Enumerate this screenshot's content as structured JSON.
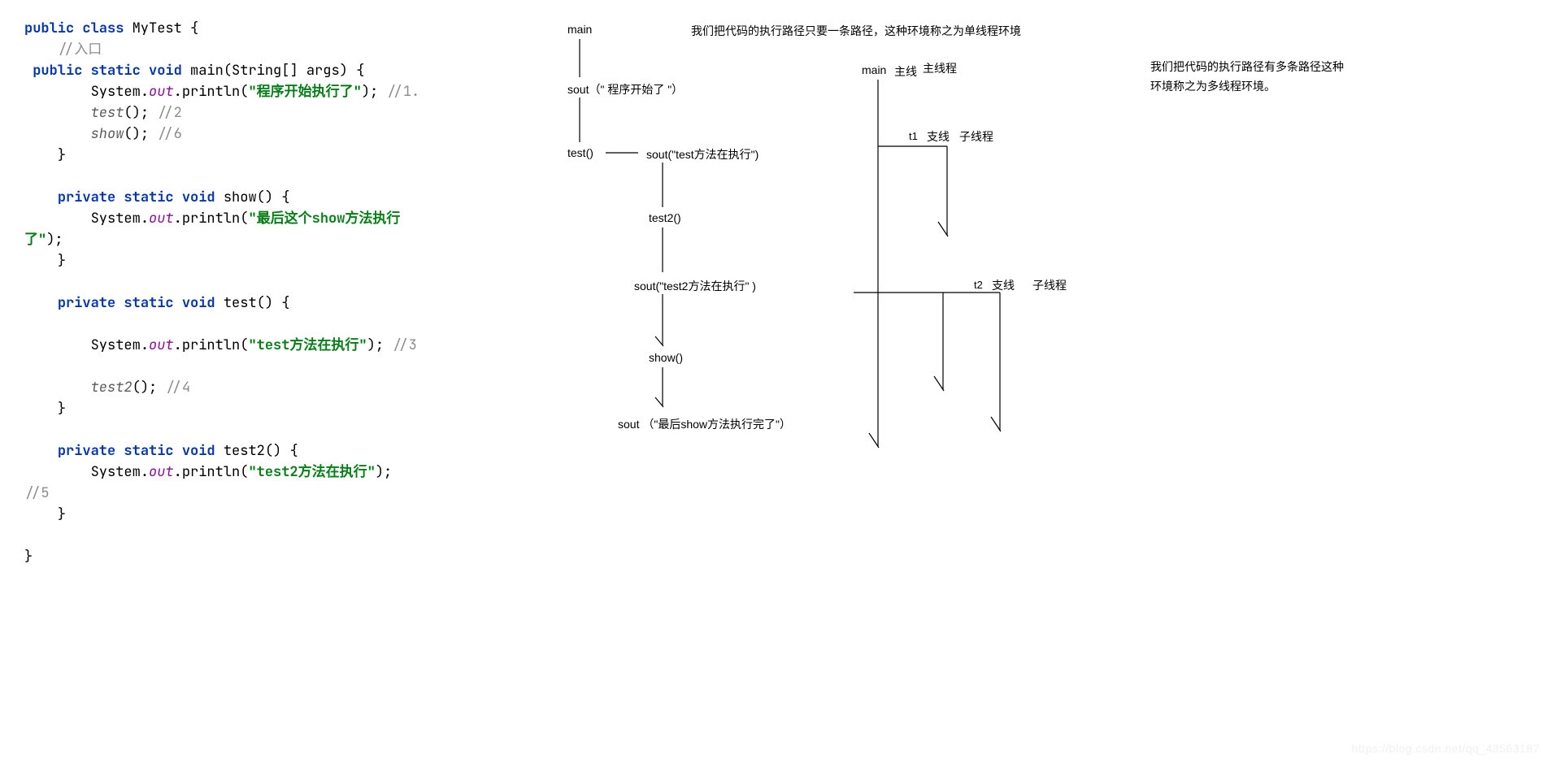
{
  "code": {
    "kw_public": "public",
    "kw_class": "class",
    "kw_static": "static",
    "kw_void": "void",
    "kw_private": "private",
    "cls_MyTest": "MyTest",
    "cls_String": "String",
    "cls_System": "System",
    "fld_out": "out",
    "mth_main": "main",
    "mth_println": "println",
    "mth_test": "test",
    "mth_show": "show",
    "mth_test2": "test2",
    "id_args": "args",
    "cmt_entry": "//入口",
    "cmt_1": "//1.",
    "cmt_2": "//2",
    "cmt_6": "//6",
    "cmt_3": "//3",
    "cmt_4": "//4",
    "cmt_5": "//5",
    "str_start": "\"程序开始执行了\"",
    "str_show": "\"最后这个show方法执行",
    "str_show_tail": "了\"",
    "str_test": "\"test方法在执行\"",
    "str_test2": "\"test2方法在执行\"",
    "brace_o": "{",
    "brace_c": "}",
    "paren_o": "(",
    "paren_c": ")",
    "brack": "[]",
    "semi": ";",
    "dot": ".",
    "sp": " "
  },
  "left_diagram": {
    "n_main": "main",
    "n_sout_start": "sout（\" 程序开始了 \"）",
    "n_test": "test()",
    "n_sout_test": "sout(\"test方法在执行\")",
    "n_test2": "test2()",
    "n_sout_test2": "sout(\"test2方法在执行\" )",
    "n_show": "show()",
    "n_sout_show": "sout （\"最后show方法执行完了\"）"
  },
  "right_diagram": {
    "main": "main",
    "zhuxian": "主线",
    "zhuxiancheng": "主线程",
    "t1": "t1",
    "t2": "t2",
    "zhixian": "支线",
    "zixiancheng": "子线程"
  },
  "notes": {
    "single": "我们把代码的执行路径只要一条路径，这种环境称之为单线程环境",
    "multi_l1": "我们把代码的执行路径有多条路径这种",
    "multi_l2": "环境称之为多线程环境。"
  },
  "watermark": "https://blog.csdn.net/qq_43563187"
}
